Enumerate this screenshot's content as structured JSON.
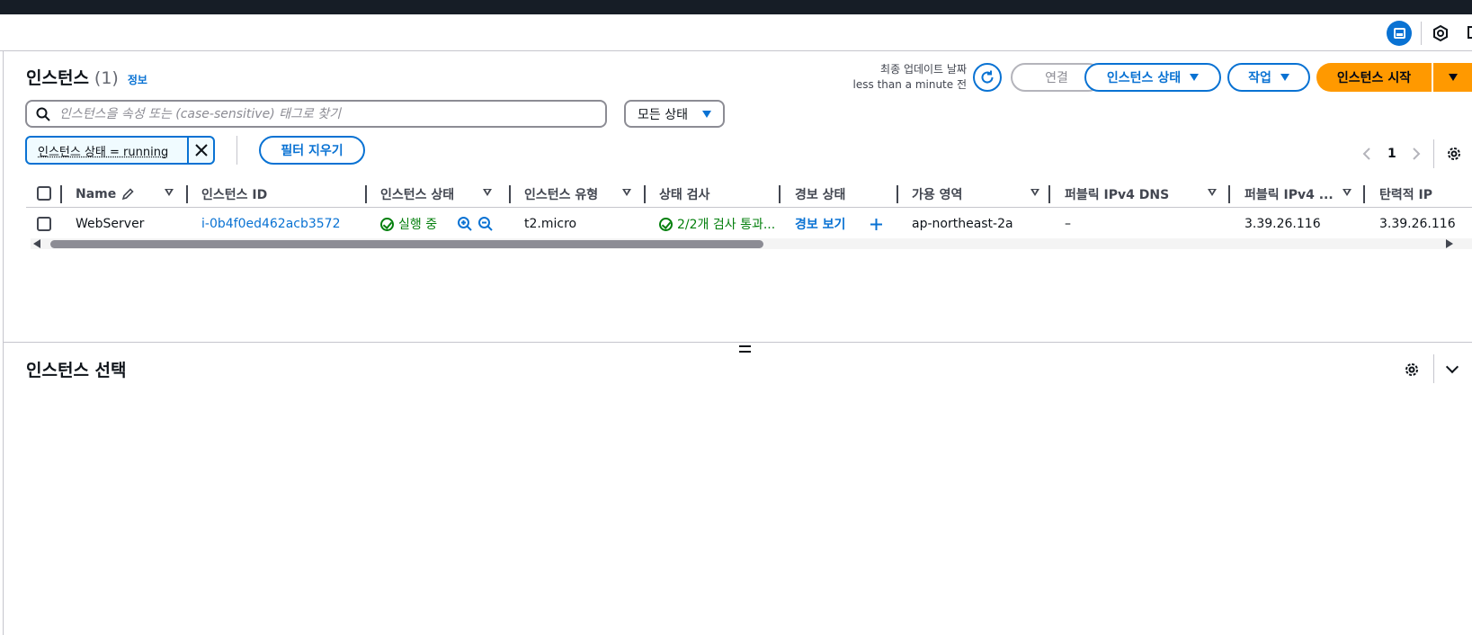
{
  "header": {
    "title": "인스턴스",
    "count": "(1)",
    "info_link": "정보",
    "last_updated_label": "최종 업데이트 날짜",
    "last_updated_value": "less than a minute 전",
    "connect_button": "연결",
    "instance_state_button": "인스턴스 상태",
    "actions_button": "작업",
    "launch_button": "인스턴스 시작"
  },
  "filters": {
    "search_placeholder": "인스턴스을 속성 또는 (case-sensitive) 태그로 찾기",
    "state_select": "모든 상태",
    "active_token": "인스턴스 상태 = running",
    "clear_button": "필터 지우기"
  },
  "pagination": {
    "current_page": "1"
  },
  "table": {
    "columns": [
      "Name",
      "인스턴스 ID",
      "인스턴스 상태",
      "인스턴스 유형",
      "상태 검사",
      "경보 상태",
      "가용 영역",
      "퍼블릭 IPv4 DNS",
      "퍼블릭 IPv4 ...",
      "탄력적 IP"
    ],
    "rows": [
      {
        "name": "WebServer",
        "instance_id": "i-0b4f0ed462acb3572",
        "state": "실행 중",
        "type": "t2.micro",
        "status_check": "2/2개 검사 통과...",
        "alarm": "경보 보기",
        "az": "ap-northeast-2a",
        "public_dns": "–",
        "public_ipv4": "3.39.26.116",
        "elastic_ip": "3.39.26.116"
      }
    ]
  },
  "details": {
    "title": "인스턴스 선택"
  },
  "colors": {
    "accent": "#0972d3",
    "primary": "#ff9900",
    "success": "#037f0c",
    "topbar": "#161d26"
  }
}
